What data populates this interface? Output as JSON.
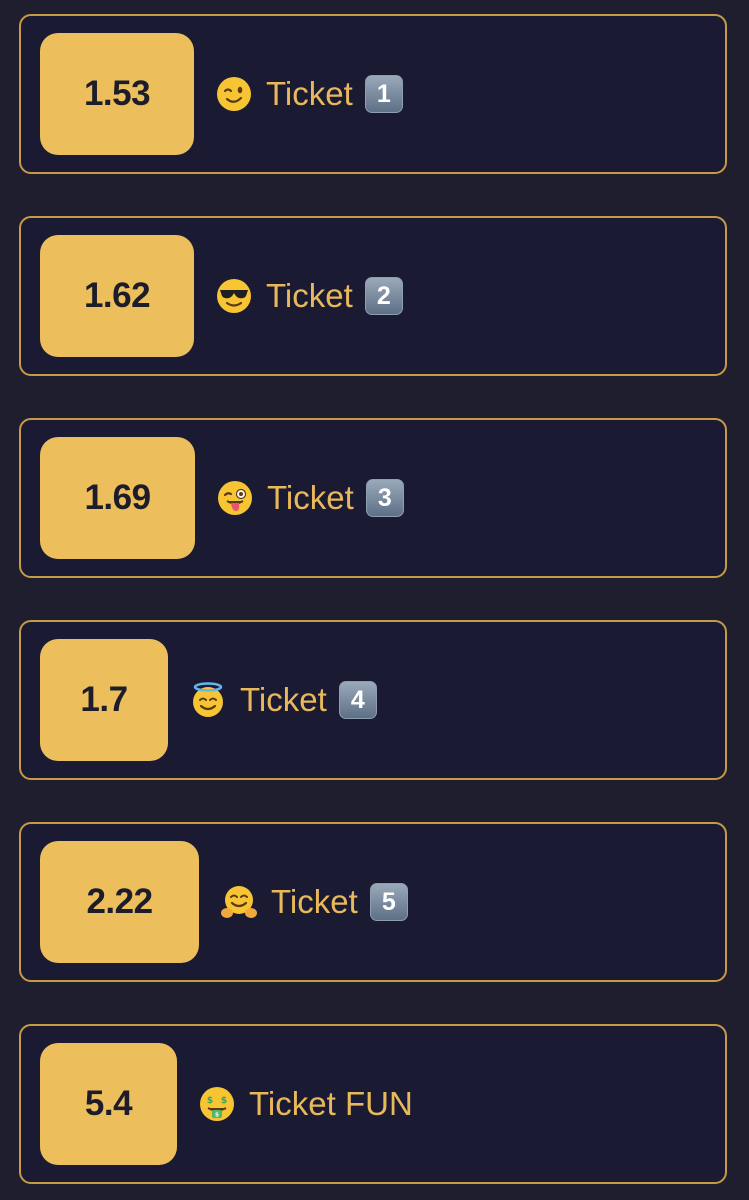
{
  "tickets": [
    {
      "odds": "1.53",
      "emoji": "winking-face-icon",
      "label": "Ticket",
      "badge": "1"
    },
    {
      "odds": "1.62",
      "emoji": "sunglasses-face-icon",
      "label": "Ticket",
      "badge": "2"
    },
    {
      "odds": "1.69",
      "emoji": "zany-tongue-face-icon",
      "label": "Ticket",
      "badge": "3"
    },
    {
      "odds": "1.7",
      "emoji": "halo-face-icon",
      "label": "Ticket",
      "badge": "4"
    },
    {
      "odds": "2.22",
      "emoji": "hugging-face-icon",
      "label": "Ticket",
      "badge": "5"
    },
    {
      "odds": "5.4",
      "emoji": "money-mouth-face-icon",
      "label": "Ticket FUN",
      "badge": ""
    }
  ],
  "colors": {
    "background": "#1e1e2f",
    "card": "#1b1a33",
    "border": "#c79a45",
    "odds_badge": "#ecbf5c",
    "label_text": "#e8b85a"
  }
}
